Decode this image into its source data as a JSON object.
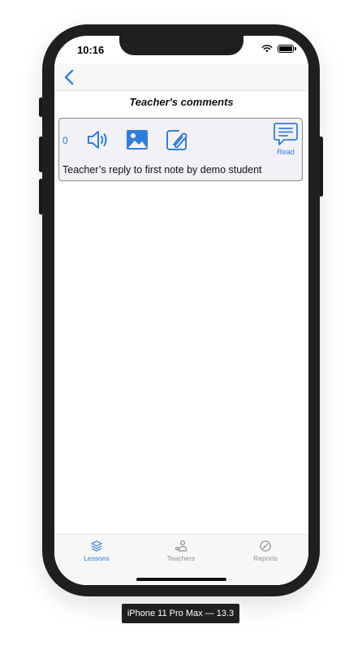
{
  "status_bar": {
    "time": "10:16"
  },
  "page": {
    "title": "Teacher's comments"
  },
  "comment": {
    "count": "0",
    "read_label": "Read",
    "text": "Teacher’s reply to first note by demo student"
  },
  "tabs": [
    {
      "label": "Lessons",
      "icon": "layers-icon",
      "active": true
    },
    {
      "label": "Teachers",
      "icon": "teacher-icon",
      "active": false
    },
    {
      "label": "Reports",
      "icon": "reports-icon",
      "active": false
    }
  ],
  "device": {
    "label": "iPhone 11 Pro Max — 13.3"
  },
  "colors": {
    "accent": "#2f7de1",
    "inactive": "#8e8e93",
    "card_bg": "#f1f1f6",
    "frame": "#1f1f1f"
  }
}
